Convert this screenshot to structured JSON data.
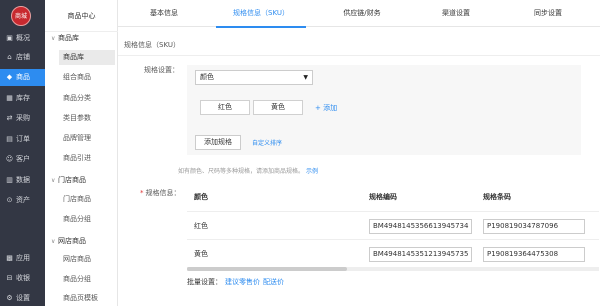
{
  "logo": {
    "text": "商城"
  },
  "rail": [
    {
      "icon": "▣",
      "label": "概况"
    },
    {
      "icon": "⌂",
      "label": "店铺"
    },
    {
      "icon": "◆",
      "label": "商品"
    },
    {
      "icon": "▦",
      "label": "库存"
    },
    {
      "icon": "⇄",
      "label": "采购"
    },
    {
      "icon": "▤",
      "label": "订单"
    },
    {
      "icon": "☺",
      "label": "客户"
    },
    {
      "icon": "▥",
      "label": "数据"
    },
    {
      "icon": "⊙",
      "label": "资产"
    },
    {
      "icon": "▩",
      "label": "应用"
    },
    {
      "icon": "⊟",
      "label": "收银"
    },
    {
      "icon": "⚙",
      "label": "设置"
    }
  ],
  "side": {
    "title": "商品中心",
    "groups": [
      {
        "label": "商品库",
        "items": [
          "商品库",
          "组合商品",
          "商品分类",
          "类目参数",
          "品牌管理",
          "商品引进"
        ]
      },
      {
        "label": "门店商品",
        "items": [
          "门店商品",
          "商品分组"
        ]
      },
      {
        "label": "网店商品",
        "items": [
          "网店商品",
          "商品分组",
          "商品页模板"
        ]
      }
    ]
  },
  "tabs": [
    "基本信息",
    "规格信息（SKU）",
    "供应链/财务",
    "渠道设置",
    "同步设置"
  ],
  "section_title": "规格信息（SKU）",
  "spec": {
    "label": "规格设置：",
    "select_value": "颜色",
    "chips": [
      "红色",
      "黄色"
    ],
    "add_link": "+ 添加",
    "add_spec_button": "添加规格",
    "custom_sort_link": "自定义排序"
  },
  "hint": {
    "text": "如有颜色、尺码等多种规格，请添加商品规格。",
    "link": "示例"
  },
  "table": {
    "label": "规格信息：",
    "headers": [
      "颜色",
      "规格编码",
      "规格条码"
    ],
    "rows": [
      {
        "color": "红色",
        "code": "BM4948145356613945734",
        "barcode": "P190819034787096"
      },
      {
        "color": "黄色",
        "code": "BM4948145351213945735",
        "barcode": "P190819364475308"
      }
    ]
  },
  "bulk": {
    "label": "批量设置：",
    "links": [
      "建议零售价",
      "配送价"
    ]
  }
}
